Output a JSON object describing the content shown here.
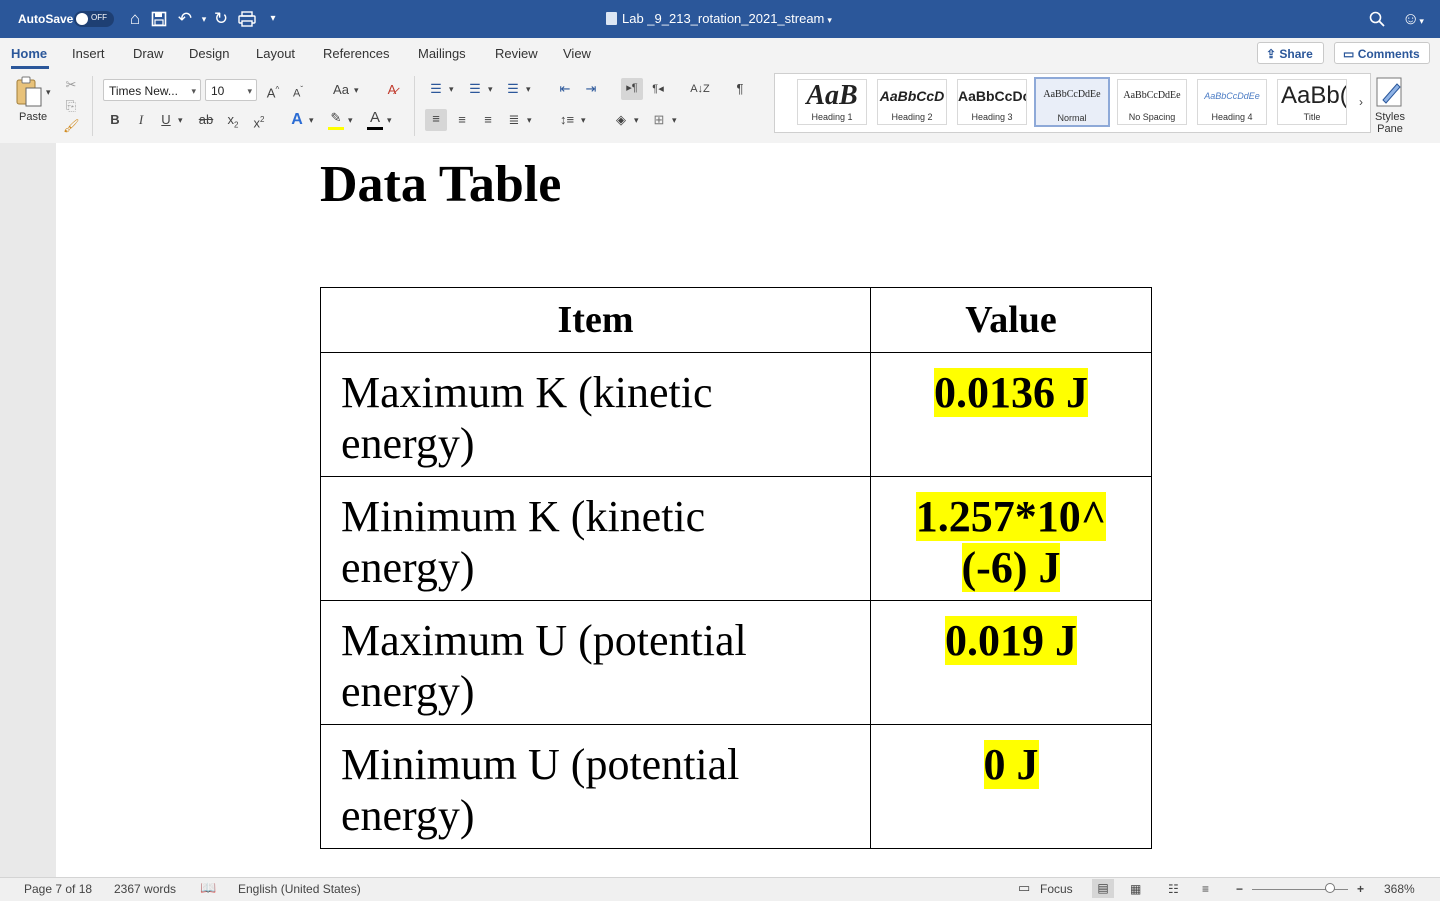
{
  "titlebar": {
    "autosave_label": "AutoSave",
    "autosave_state": "OFF",
    "document_title": "Lab _9_213_rotation_2021_stream"
  },
  "ribbon": {
    "tabs": [
      "Home",
      "Insert",
      "Draw",
      "Design",
      "Layout",
      "References",
      "Mailings",
      "Review",
      "View"
    ],
    "active_tab": "Home",
    "share_label": "Share",
    "comments_label": "Comments"
  },
  "toolbar": {
    "paste_label": "Paste",
    "font_name": "Times New...",
    "font_size": "10",
    "bold": "B",
    "italic": "I",
    "underline": "U",
    "strike": "ab",
    "change_case": "Aa",
    "pilcrow": "¶",
    "highlight_color": "#ffff00",
    "font_color": "#000000"
  },
  "styles": {
    "items": [
      {
        "sample": "AaB",
        "name": "Heading 1"
      },
      {
        "sample": "AaBbCcD",
        "name": "Heading 2"
      },
      {
        "sample": "AaBbCcDc",
        "name": "Heading 3"
      },
      {
        "sample": "AaBbCcDdEe",
        "name": "Normal"
      },
      {
        "sample": "AaBbCcDdEe",
        "name": "No Spacing"
      },
      {
        "sample": "AaBbCcDdEe",
        "name": "Heading 4"
      },
      {
        "sample": "AaBb(",
        "name": "Title"
      }
    ],
    "selected": "Normal",
    "pane_label_1": "Styles",
    "pane_label_2": "Pane"
  },
  "document": {
    "heading": "Data Table",
    "table": {
      "headers": [
        "Item",
        "Value"
      ],
      "rows": [
        {
          "item_line1": "Maximum K (kinetic",
          "item_line2": "energy)",
          "value": "0.0136 J"
        },
        {
          "item_line1": "Minimum K (kinetic",
          "item_line2": "energy)",
          "value": "1.257*10^ (-6) J"
        },
        {
          "item_line1": "Maximum U (potential",
          "item_line2": "energy)",
          "value": "0.019 J"
        },
        {
          "item_line1": "Minimum U (potential",
          "item_line2": "energy)",
          "value": "0 J"
        }
      ]
    }
  },
  "statusbar": {
    "page": "Page 7 of 18",
    "words": "2367 words",
    "language": "English (United States)",
    "focus_label": "Focus",
    "zoom": "368%"
  },
  "colors": {
    "brand": "#2b579a",
    "highlight": "#ffff00"
  }
}
